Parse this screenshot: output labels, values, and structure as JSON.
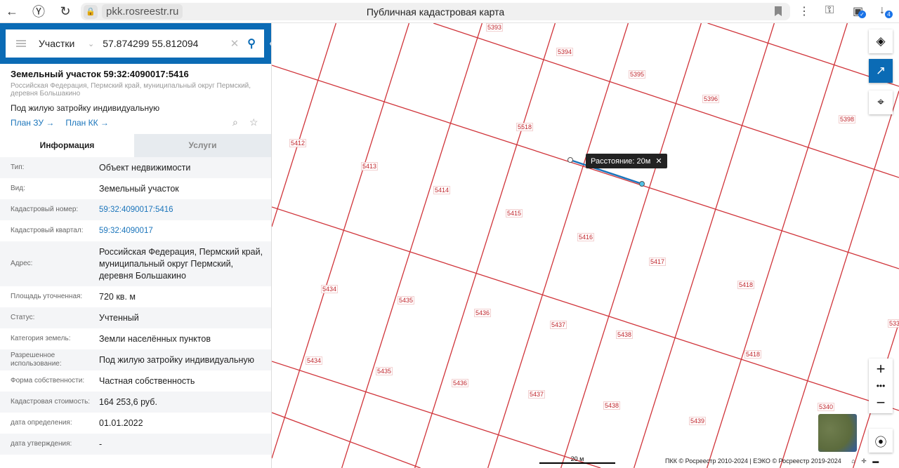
{
  "browser": {
    "host": "pkk.rosreestr.ru",
    "title": "Публичная кадастровая карта",
    "download_count": "4"
  },
  "search": {
    "layer": "Участки",
    "query": "57.874299 55.812094"
  },
  "object": {
    "title": "Земельный участок 59:32:4090017:5416",
    "address": "Российская Федерация, Пермский край, муниципальный округ Пермский, деревня Большакино",
    "purpose": "Под жилую затройку индивидуальную",
    "link_plan_zu": "План ЗУ →",
    "link_plan_kk": "План КК →"
  },
  "tabs": [
    "Информация",
    "Услуги"
  ],
  "fields": [
    {
      "label": "Тип:",
      "value": "Объект недвижимости"
    },
    {
      "label": "Вид:",
      "value": "Земельный участок"
    },
    {
      "label": "Кадастровый номер:",
      "value": "59:32:4090017:5416",
      "link": true
    },
    {
      "label": "Кадастровый квартал:",
      "value": "59:32:4090017",
      "link": true
    },
    {
      "label": "Адрес:",
      "value": "Российская Федерация, Пермский край, муниципальный округ Пермский, деревня Большакино"
    },
    {
      "label": "Площадь уточненная:",
      "value": "720 кв. м"
    },
    {
      "label": "Статус:",
      "value": "Учтенный"
    },
    {
      "label": "Категория земель:",
      "value": "Земли населённых пунктов"
    },
    {
      "label": "Разрешенное использование:",
      "value": "Под жилую затройку индивидуальную"
    },
    {
      "label": "Форма собственности:",
      "value": "Частная собственность"
    },
    {
      "label": "Кадастровая стоимость:",
      "value": "164 253,6 руб."
    },
    {
      "label": "дата определения:",
      "value": "01.01.2022"
    },
    {
      "label": "дата утверждения:",
      "value": "-"
    }
  ],
  "map": {
    "parcels": [
      "5393",
      "5394",
      "5395",
      "5396",
      "5398",
      "5518",
      "5412",
      "5413",
      "5414",
      "5415",
      "5416",
      "5417",
      "5418",
      "5434",
      "5435",
      "5436",
      "5437",
      "5438",
      "5434",
      "5435",
      "5436",
      "5437",
      "5438",
      "5418",
      "5439",
      "5340",
      "533"
    ],
    "measure_label": "Расстояние: 20м",
    "scale_label": "20 м",
    "attribution": "ПКК © Росреестр 2010-2024 | ЕЭКО © Росреестр 2019-2024",
    "line_color": "#d0343a",
    "measure_color": "#1b75bb"
  }
}
